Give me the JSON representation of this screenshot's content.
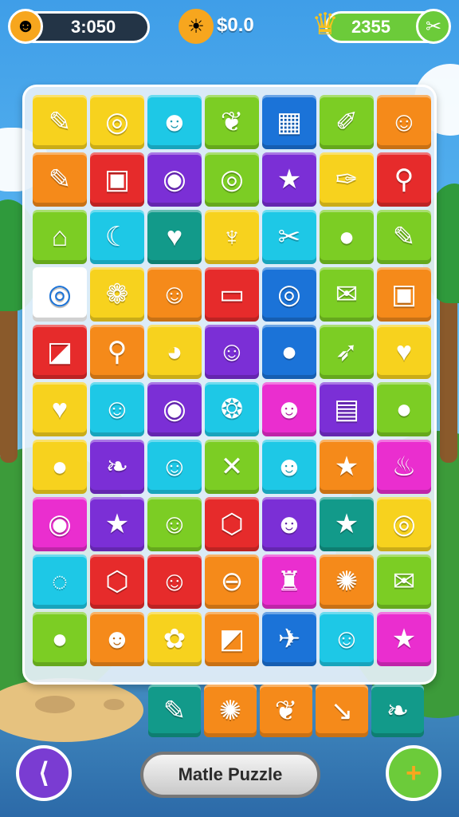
{
  "hud": {
    "timer": "3:050",
    "timer_icon": "smiley-icon",
    "coins": "$0.0",
    "coin_icon": "sun-face-icon",
    "score": "2355",
    "score_icon": "trophy-icon",
    "settings_icon": "scissors-icon"
  },
  "colors": {
    "yellow": "#f7d21e",
    "orange": "#f58a1a",
    "cyan": "#1ec8e6",
    "green": "#7ccd24",
    "blue": "#1b73d8",
    "purple": "#7b2fd6",
    "red": "#e62b2b",
    "magenta": "#ea2ecf",
    "teal": "#129a8a",
    "white": "#ffffff"
  },
  "board": {
    "rows": [
      [
        {
          "c": "yellow",
          "g": "✎",
          "n": "pencil-icon"
        },
        {
          "c": "yellow",
          "g": "◎",
          "n": "ring-icon"
        },
        {
          "c": "cyan",
          "g": "☻",
          "n": "face-icon"
        },
        {
          "c": "green",
          "g": "❦",
          "n": "leaf-icon"
        },
        {
          "c": "blue",
          "g": "▦",
          "n": "box-icon"
        },
        {
          "c": "green",
          "g": "✐",
          "n": "marker-icon"
        },
        {
          "c": "orange",
          "g": "☺",
          "n": "sun-face-icon"
        }
      ],
      [
        {
          "c": "orange",
          "g": "✎",
          "n": "pencil-icon"
        },
        {
          "c": "red",
          "g": "▣",
          "n": "screen-icon"
        },
        {
          "c": "purple",
          "g": "◉",
          "n": "ring-icon"
        },
        {
          "c": "green",
          "g": "◎",
          "n": "ring-icon"
        },
        {
          "c": "purple",
          "g": "★",
          "n": "star-icon"
        },
        {
          "c": "yellow",
          "g": "✑",
          "n": "bottle-icon"
        },
        {
          "c": "red",
          "g": "⚲",
          "n": "magnifier-icon"
        }
      ],
      [
        {
          "c": "green",
          "g": "⌂",
          "n": "house-icon"
        },
        {
          "c": "cyan",
          "g": "☾",
          "n": "moon-icon"
        },
        {
          "c": "teal",
          "g": "♥",
          "n": "heart-icon"
        },
        {
          "c": "yellow",
          "g": "♆",
          "n": "pin-icon"
        },
        {
          "c": "cyan",
          "g": "✂",
          "n": "tag-icon"
        },
        {
          "c": "green",
          "g": "●",
          "n": "pumpkin-icon"
        },
        {
          "c": "green",
          "g": "✎",
          "n": "pencil-icon"
        }
      ],
      [
        {
          "c": "white",
          "g": "◎",
          "n": "ring-icon"
        },
        {
          "c": "yellow",
          "g": "❁",
          "n": "flower-icon"
        },
        {
          "c": "orange",
          "g": "☺",
          "n": "face-icon"
        },
        {
          "c": "red",
          "g": "▭",
          "n": "battery-icon"
        },
        {
          "c": "blue",
          "g": "◎",
          "n": "ring-icon"
        },
        {
          "c": "green",
          "g": "✉",
          "n": "tag-icon"
        },
        {
          "c": "orange",
          "g": "▣",
          "n": "play-icon"
        }
      ],
      [
        {
          "c": "red",
          "g": "◪",
          "n": "square-icon"
        },
        {
          "c": "orange",
          "g": "⚲",
          "n": "magnifier-icon"
        },
        {
          "c": "yellow",
          "g": "◕",
          "n": "berry-icon"
        },
        {
          "c": "purple",
          "g": "☺",
          "n": "face-icon"
        },
        {
          "c": "blue",
          "g": "●",
          "n": "tomato-icon"
        },
        {
          "c": "green",
          "g": "➶",
          "n": "carrot-icon"
        },
        {
          "c": "yellow",
          "g": "♥",
          "n": "heart-icon"
        }
      ],
      [
        {
          "c": "yellow",
          "g": "♥",
          "n": "heart-icon"
        },
        {
          "c": "cyan",
          "g": "☺",
          "n": "cat-face-icon"
        },
        {
          "c": "purple",
          "g": "◉",
          "n": "ring-icon"
        },
        {
          "c": "cyan",
          "g": "❂",
          "n": "fruit-icon"
        },
        {
          "c": "magenta",
          "g": "☻",
          "n": "tomato-icon"
        },
        {
          "c": "purple",
          "g": "▤",
          "n": "radio-icon"
        },
        {
          "c": "green",
          "g": "●",
          "n": "pumpkin-icon"
        }
      ],
      [
        {
          "c": "yellow",
          "g": "●",
          "n": "ball-icon"
        },
        {
          "c": "purple",
          "g": "❧",
          "n": "leaf-icon"
        },
        {
          "c": "cyan",
          "g": "☺",
          "n": "ghost-icon"
        },
        {
          "c": "green",
          "g": "✕",
          "n": "crossed-tools-icon"
        },
        {
          "c": "cyan",
          "g": "☻",
          "n": "ghost-icon"
        },
        {
          "c": "orange",
          "g": "★",
          "n": "star-icon"
        },
        {
          "c": "magenta",
          "g": "♨",
          "n": "flame-icon"
        }
      ],
      [
        {
          "c": "magenta",
          "g": "◉",
          "n": "heart-ring-icon"
        },
        {
          "c": "purple",
          "g": "★",
          "n": "star-icon"
        },
        {
          "c": "green",
          "g": "☺",
          "n": "face-icon"
        },
        {
          "c": "red",
          "g": "⬡",
          "n": "shield-icon"
        },
        {
          "c": "purple",
          "g": "☻",
          "n": "ghost-icon"
        },
        {
          "c": "teal",
          "g": "★",
          "n": "star-icon"
        },
        {
          "c": "yellow",
          "g": "◎",
          "n": "ring-icon"
        }
      ],
      [
        {
          "c": "cyan",
          "g": "◌",
          "n": "bubble-icon"
        },
        {
          "c": "red",
          "g": "⬡",
          "n": "gem-icon"
        },
        {
          "c": "red",
          "g": "☺",
          "n": "creature-icon"
        },
        {
          "c": "orange",
          "g": "⊖",
          "n": "coin-icon"
        },
        {
          "c": "magenta",
          "g": "♜",
          "n": "cup-icon"
        },
        {
          "c": "orange",
          "g": "✺",
          "n": "sun-face-icon"
        },
        {
          "c": "green",
          "g": "✉",
          "n": "envelope-icon"
        }
      ],
      [
        {
          "c": "green",
          "g": "●",
          "n": "pumpkin-icon"
        },
        {
          "c": "orange",
          "g": "☻",
          "n": "creature-icon"
        },
        {
          "c": "yellow",
          "g": "✿",
          "n": "flower-icon"
        },
        {
          "c": "orange",
          "g": "◩",
          "n": "gift-icon"
        },
        {
          "c": "blue",
          "g": "✈",
          "n": "dolphin-icon"
        },
        {
          "c": "cyan",
          "g": "☺",
          "n": "face-icon"
        },
        {
          "c": "magenta",
          "g": "★",
          "n": "star-icon"
        }
      ]
    ]
  },
  "tray": [
    {
      "c": "teal",
      "g": "✎",
      "n": "twig-icon"
    },
    {
      "c": "orange",
      "g": "✺",
      "n": "flower-icon"
    },
    {
      "c": "orange",
      "g": "❦",
      "n": "leaf-icon"
    },
    {
      "c": "orange",
      "g": "↘",
      "n": "pipe-icon"
    },
    {
      "c": "teal",
      "g": "❧",
      "n": "leaf-icon"
    }
  ],
  "footer": {
    "share_icon": "share-icon",
    "title": "Matle Puzzle",
    "add_icon": "plus-icon"
  }
}
